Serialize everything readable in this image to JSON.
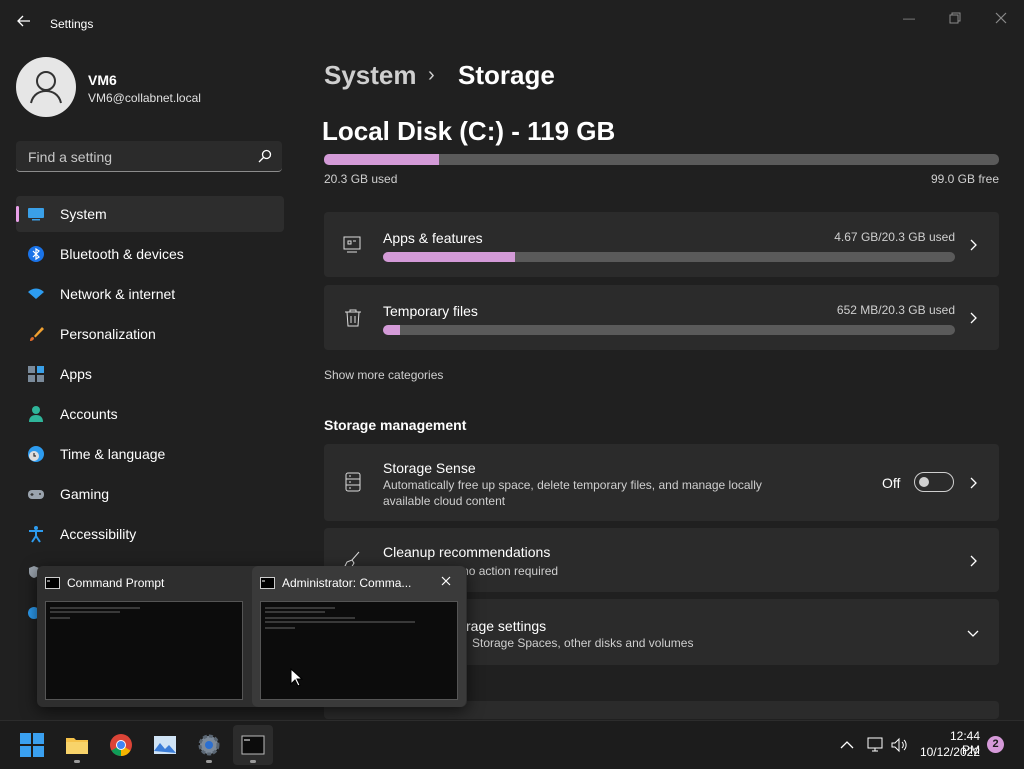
{
  "window": {
    "title": "Settings"
  },
  "profile": {
    "name": "VM6",
    "email": "VM6@collabnet.local"
  },
  "search": {
    "placeholder": "Find a setting"
  },
  "sidebar": {
    "items": [
      {
        "label": "System",
        "icon": "system-icon",
        "selected": true
      },
      {
        "label": "Bluetooth & devices",
        "icon": "bluetooth-icon"
      },
      {
        "label": "Network & internet",
        "icon": "wifi-icon"
      },
      {
        "label": "Personalization",
        "icon": "brush-icon"
      },
      {
        "label": "Apps",
        "icon": "apps-icon"
      },
      {
        "label": "Accounts",
        "icon": "accounts-icon"
      },
      {
        "label": "Time & language",
        "icon": "clock-globe-icon"
      },
      {
        "label": "Gaming",
        "icon": "gamepad-icon"
      },
      {
        "label": "Accessibility",
        "icon": "accessibility-icon"
      }
    ]
  },
  "breadcrumb": {
    "parent": "System",
    "separator": "›",
    "current": "Storage"
  },
  "disk": {
    "title": "Local Disk (C:) - 119 GB",
    "used": "20.3 GB used",
    "free": "99.0 GB free",
    "used_fraction": 0.17
  },
  "categories": [
    {
      "title": "Apps & features",
      "usage": "4.67 GB/20.3 GB used",
      "fraction": 0.23
    },
    {
      "title": "Temporary files",
      "usage": "652 MB/20.3 GB used",
      "fraction": 0.03
    }
  ],
  "show_more": "Show more categories",
  "storage_management": {
    "header": "Storage management",
    "storage_sense": {
      "title": "Storage Sense",
      "desc": "Automatically free up space, delete temporary files, and manage locally available cloud content",
      "toggle_label": "Off",
      "toggle_on": false
    },
    "cleanup": {
      "title": "Cleanup recommendations",
      "desc": "ed, no action required"
    },
    "advanced": {
      "title": "rage settings",
      "desc": "Storage Spaces, other disks and volumes"
    }
  },
  "task_popup": {
    "windows": [
      {
        "title": "Command Prompt"
      },
      {
        "title": "Administrator: Comma..."
      }
    ]
  },
  "taskbar": {
    "apps": [
      "start-icon",
      "file-explorer-icon",
      "chrome-icon",
      "photos-icon",
      "settings-icon",
      "terminal-icon"
    ],
    "time": "12:44 PM",
    "date": "10/12/2022",
    "notifications": "2"
  },
  "colors": {
    "accent": "#d39ad7",
    "background": "#202020",
    "card": "#2b2b2b"
  }
}
